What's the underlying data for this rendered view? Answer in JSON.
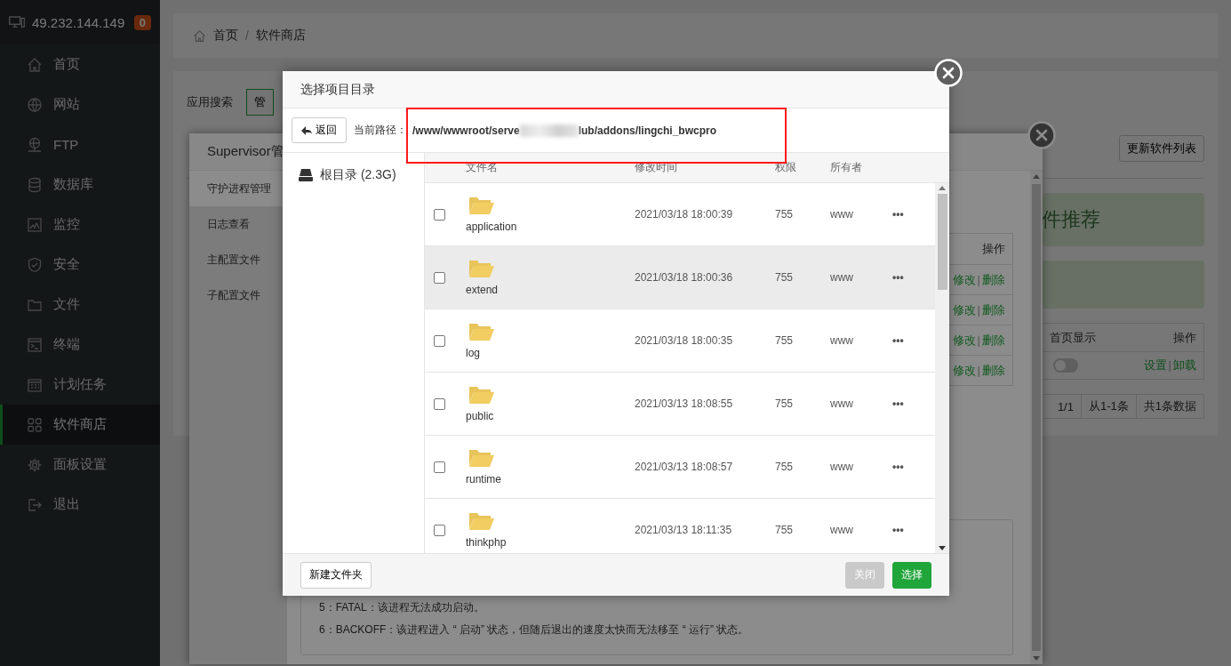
{
  "sidebar": {
    "host": "49.232.144.149",
    "badge": "0",
    "items": [
      {
        "label": "首页",
        "selected": false
      },
      {
        "label": "网站",
        "selected": false
      },
      {
        "label": "FTP",
        "selected": false
      },
      {
        "label": "数据库",
        "selected": false
      },
      {
        "label": "监控",
        "selected": false
      },
      {
        "label": "安全",
        "selected": false
      },
      {
        "label": "文件",
        "selected": false
      },
      {
        "label": "终端",
        "selected": false
      },
      {
        "label": "计划任务",
        "selected": false
      },
      {
        "label": "软件商店",
        "selected": true
      },
      {
        "label": "面板设置",
        "selected": false
      },
      {
        "label": "退出",
        "selected": false
      }
    ]
  },
  "breadcrumb": {
    "items": [
      "首页",
      "软件商店"
    ],
    "separator": "/"
  },
  "store": {
    "search_label": "应用搜索",
    "filter_button": "管",
    "update_button": "更新软件列表",
    "banner": "件推荐",
    "table": {
      "columns": [
        "首页显示",
        "操作"
      ],
      "rows": [
        {
          "home_display": false,
          "actions": [
            "设置",
            "卸载"
          ],
          "separator": "|"
        }
      ]
    },
    "pagination": [
      "1/1",
      "从1-1条",
      "共1条数据"
    ]
  },
  "supervisor": {
    "title": "Supervisor管",
    "tabs": [
      {
        "label": "守护进程管理",
        "selected": true
      },
      {
        "label": "日志查看",
        "selected": false
      },
      {
        "label": "主配置文件",
        "selected": false
      },
      {
        "label": "子配置文件",
        "selected": false
      }
    ],
    "table": {
      "column": "操作",
      "rows": [
        {
          "actions": [
            "修改",
            "删除"
          ],
          "separator": "|"
        },
        {
          "actions": [
            "修改",
            "删除"
          ],
          "separator": "|"
        },
        {
          "actions": [
            "修改",
            "删除"
          ],
          "separator": "|"
        },
        {
          "actions": [
            "修改",
            "删除"
          ],
          "separator": "|"
        }
      ]
    },
    "notes": [
      "5：FATAL：该进程无法成功启动。",
      "6：BACKOFF：该进程进入 “ 启动” 状态，但随后退出的速度太快而无法移至 “ 运行” 状态。"
    ]
  },
  "dialog": {
    "title": "选择项目目录",
    "back_button": "返回",
    "path_label": "当前路径：",
    "path": [
      "/www/wwwroot/serve",
      "lub/addons/lingchi_bwcpro"
    ],
    "disk": "根目录 (2.3G)",
    "columns": [
      "文件名",
      "修改时间",
      "权限",
      "所有者"
    ],
    "rows": [
      {
        "name": "application",
        "modified": "2021/03/18 18:00:39",
        "permission": "755",
        "owner": "www",
        "more": "•••",
        "checked": false,
        "hovered": false
      },
      {
        "name": "extend",
        "modified": "2021/03/18 18:00:36",
        "permission": "755",
        "owner": "www",
        "more": "•••",
        "checked": false,
        "hovered": true
      },
      {
        "name": "log",
        "modified": "2021/03/18 18:00:35",
        "permission": "755",
        "owner": "www",
        "more": "•••",
        "checked": false,
        "hovered": false
      },
      {
        "name": "public",
        "modified": "2021/03/13 18:08:55",
        "permission": "755",
        "owner": "www",
        "more": "•••",
        "checked": false,
        "hovered": false
      },
      {
        "name": "runtime",
        "modified": "2021/03/13 18:08:57",
        "permission": "755",
        "owner": "www",
        "more": "•••",
        "checked": false,
        "hovered": false
      },
      {
        "name": "thinkphp",
        "modified": "2021/03/13 18:11:35",
        "permission": "755",
        "owner": "www",
        "more": "•••",
        "checked": false,
        "hovered": false
      }
    ],
    "new_folder_button": "新建文件夹",
    "close_button": {
      "label": "关闭",
      "disabled": true
    },
    "select_button": "选择"
  }
}
